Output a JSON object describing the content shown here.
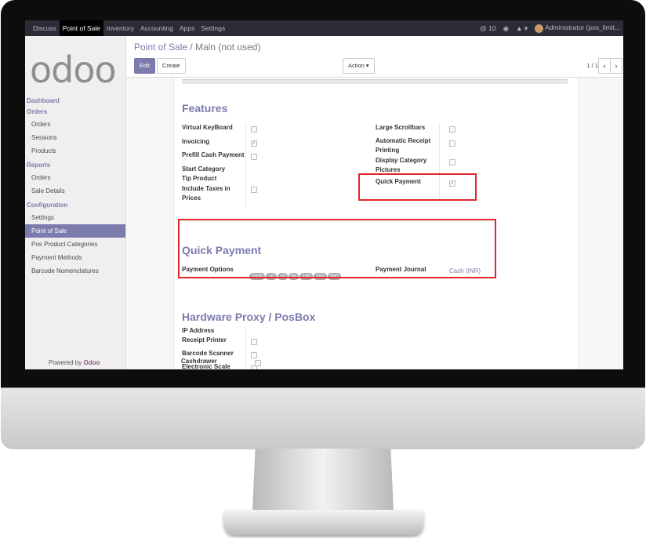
{
  "topbar": {
    "menu": [
      "Discuss",
      "Point of Sale",
      "Inventory",
      "Accounting",
      "Apps",
      "Settings"
    ],
    "active": "Point of Sale",
    "notification_count": "10",
    "user": "Administrator (pos_limit..."
  },
  "sidebar": {
    "logo": "odoo",
    "sections": [
      {
        "title": "Dashboard",
        "items": []
      },
      {
        "title": "Orders",
        "items": [
          "Orders",
          "Sessions",
          "Products"
        ]
      },
      {
        "title": "Reports",
        "items": [
          "Orders",
          "Sale Details"
        ]
      },
      {
        "title": "Configuration",
        "items": [
          "Settings",
          "Point of Sale",
          "Pos Product Categories",
          "Payment Methods",
          "Barcode Nomenclatures"
        ]
      }
    ],
    "selected": "Point of Sale",
    "powered_by": "Powered by",
    "powered_brand": "Odoo"
  },
  "control_panel": {
    "breadcrumb_parent": "Point of Sale",
    "breadcrumb_sep": "/",
    "breadcrumb_current": "Main (not used)",
    "edit_label": "Edit",
    "create_label": "Create",
    "action_label": "Action ▾",
    "pager": "1 / 1"
  },
  "features": {
    "title": "Features",
    "left": [
      {
        "label": "Virtual KeyBoard",
        "checked": false
      },
      {
        "label": "Invoicing",
        "checked": true
      },
      {
        "label": "Prefill Cash Payment",
        "checked": false
      },
      {
        "label": "Start Category",
        "checked": null
      },
      {
        "label": "Tip Product",
        "checked": null
      },
      {
        "label": "Include Taxes in Prices",
        "checked": false
      }
    ],
    "right": [
      {
        "label": "Large Scrollbars",
        "checked": false
      },
      {
        "label": "Automatic Receipt Printing",
        "checked": false
      },
      {
        "label": "Display Category Pictures",
        "checked": false
      },
      {
        "label": "Quick Payment",
        "checked": true
      }
    ]
  },
  "quick_payment": {
    "title": "Quick Payment",
    "options_label": "Payment Options",
    "options": [
      "2000",
      "10",
      "20",
      "50",
      "100",
      "200",
      "500"
    ],
    "journal_label": "Payment Journal",
    "journal_value": "Cash (INR)"
  },
  "hardware": {
    "title": "Hardware Proxy / PosBox",
    "fields": [
      {
        "label": "IP Address",
        "checked": null
      },
      {
        "label": "Receipt Printer",
        "checked": false
      },
      {
        "label": "Barcode Scanner",
        "checked": false
      },
      {
        "label": "Electronic Scale",
        "checked": false
      },
      {
        "label": "Cashdrawer",
        "checked": false
      }
    ]
  },
  "colors": {
    "brand": "#7c7bad",
    "highlight": "#e0262b"
  }
}
